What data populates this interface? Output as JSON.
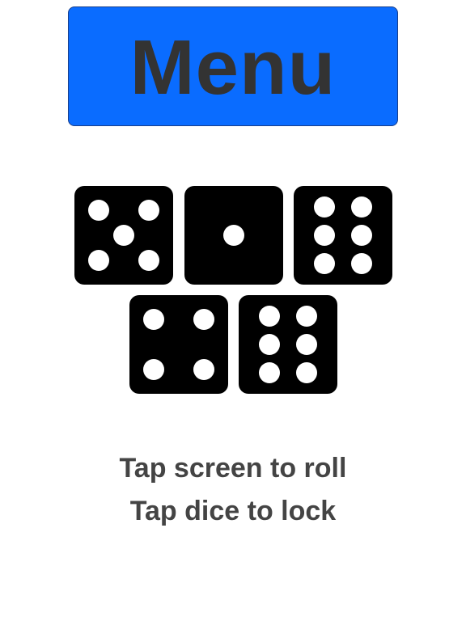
{
  "menu_button": {
    "label": "Menu",
    "color": "#0a6cff",
    "text_color": "#333333"
  },
  "dice": [
    {
      "value": 5
    },
    {
      "value": 1
    },
    {
      "value": 6
    },
    {
      "value": 4
    },
    {
      "value": 6
    }
  ],
  "instructions": {
    "line_1": "Tap screen to roll",
    "line_2": "Tap dice to lock",
    "color": "#444444"
  },
  "colors": {
    "background": "#ffffff",
    "die_face": "#000000",
    "pip": "#ffffff"
  }
}
